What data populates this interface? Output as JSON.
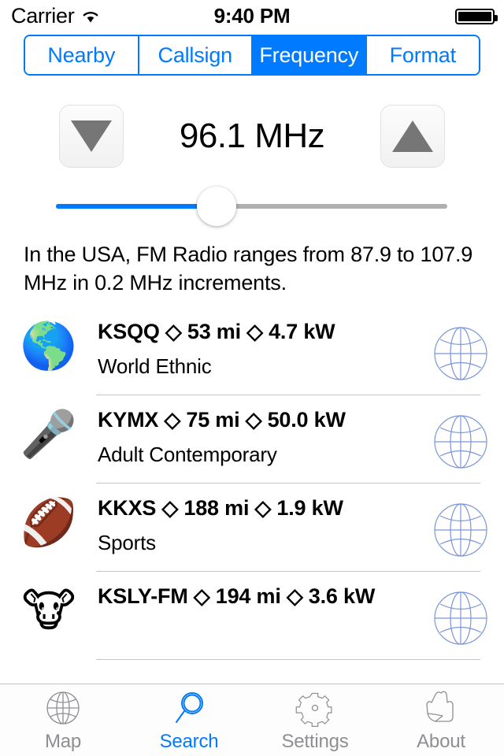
{
  "status_bar": {
    "carrier": "Carrier",
    "wifi_icon": "wifi-icon",
    "time": "9:40 PM",
    "battery_icon": "battery-full-icon"
  },
  "segmented_control": {
    "accent_color": "#007AFF",
    "segments": [
      {
        "label": "Nearby",
        "active": false
      },
      {
        "label": "Callsign",
        "active": false
      },
      {
        "label": "Frequency",
        "active": true
      },
      {
        "label": "Format",
        "active": false
      }
    ]
  },
  "frequency": {
    "value_label": "96.1 MHz",
    "decrement_icon": "triangle-down-icon",
    "increment_icon": "triangle-up-icon",
    "slider": {
      "value": 96.1,
      "min": 87.9,
      "max": 107.9,
      "step": 0.2,
      "fill_percent": 41,
      "fill_color": "#007AFF",
      "track_color": "#b0b0b0"
    }
  },
  "description": {
    "text": "In the USA, FM Radio ranges from 87.9 to 107.9 MHz in 0.2 MHz increments."
  },
  "stations": [
    {
      "emoji": "🌎",
      "emoji_name": "globe-americas-emoji",
      "title": "KSQQ ◇ 53 mi ◇ 4.7 kW",
      "callsign": "KSQQ",
      "distance": "53 mi",
      "power": "4.7 kW",
      "format": "World Ethnic",
      "accessory_icon": "globe-icon"
    },
    {
      "emoji": "🎤",
      "emoji_name": "microphone-emoji",
      "title": "KYMX ◇ 75 mi ◇ 50.0 kW",
      "callsign": "KYMX",
      "distance": "75 mi",
      "power": "50.0 kW",
      "format": "Adult Contemporary",
      "accessory_icon": "globe-icon"
    },
    {
      "emoji": "🏈",
      "emoji_name": "football-emoji",
      "title": "KKXS ◇ 188 mi ◇ 1.9 kW",
      "callsign": "KKXS",
      "distance": "188 mi",
      "power": "1.9 kW",
      "format": "Sports",
      "accessory_icon": "globe-icon"
    },
    {
      "emoji": "🐮",
      "emoji_name": "cow-face-emoji",
      "title": "KSLY-FM ◇ 194 mi ◇ 3.6 kW",
      "callsign": "KSLY-FM",
      "distance": "194 mi",
      "power": "3.6 kW",
      "format": "",
      "accessory_icon": "globe-icon"
    }
  ],
  "tab_bar": {
    "active_color": "#007AFF",
    "inactive_color": "#8e8e93",
    "tabs": [
      {
        "label": "Map",
        "icon": "globe-icon",
        "active": false
      },
      {
        "label": "Search",
        "icon": "magnifier-icon",
        "active": true
      },
      {
        "label": "Settings",
        "icon": "gear-icon",
        "active": false
      },
      {
        "label": "About",
        "icon": "hand-icon",
        "active": false
      }
    ]
  }
}
